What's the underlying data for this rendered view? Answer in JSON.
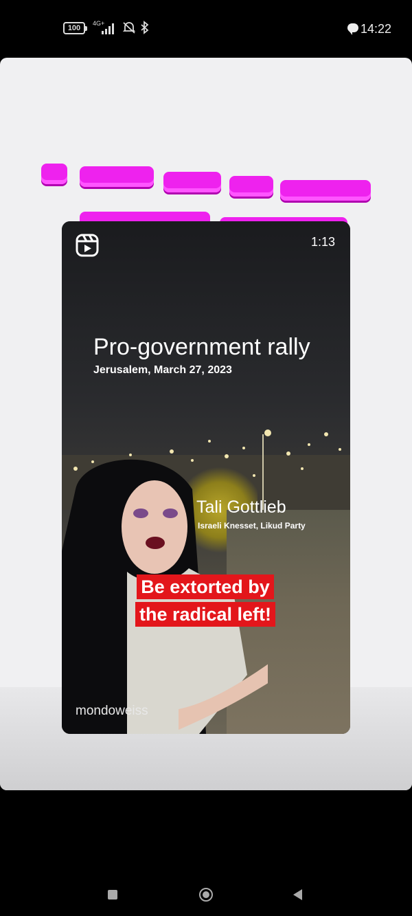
{
  "status_bar": {
    "battery": "100",
    "network": "4G+",
    "time": "14:22"
  },
  "video": {
    "duration": "1:13",
    "headline": "Pro-government rally",
    "dateline": "Jerusalem, March 27, 2023",
    "person_name": "Tali Gottlieb",
    "person_role": "Israeli Knesset, Likud Party",
    "caption_line1": "Be extorted by",
    "caption_line2": "the radical left!",
    "watermark": "mondoweiss"
  },
  "colors": {
    "redaction": "#ee22ee",
    "caption_bg": "#e3161b",
    "card_bg": "#f0f0f2"
  },
  "icons": [
    "battery-icon",
    "signal-icon",
    "mute-icon",
    "bluetooth-icon",
    "chat-icon",
    "reels-icon",
    "recent-apps-icon",
    "home-icon",
    "back-icon"
  ]
}
